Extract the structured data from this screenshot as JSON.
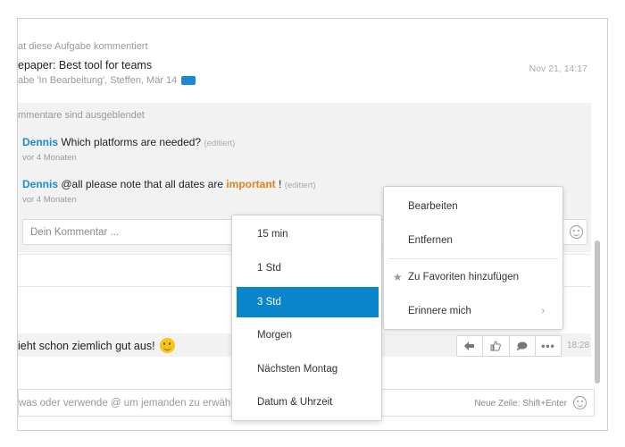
{
  "activity": {
    "header": "at diese Aufgabe kommentiert",
    "title": "epaper: Best tool for teams",
    "meta": "abe 'In Bearbeitung', Steffen, Mär 14",
    "time": "Nov 21, 14:17"
  },
  "comments": {
    "hidden_note": "mmentare sind ausgeblendet",
    "items": [
      {
        "author": "Dennis",
        "text": "Which platforms are needed?",
        "edited": "(editiert)",
        "time": "vor 4 Monaten"
      },
      {
        "author": "Dennis",
        "text_before": "@all please note that all dates are",
        "highlight": "important",
        "text_after": "!",
        "edited": "(editiert)",
        "time": "vor 4 Monaten"
      }
    ],
    "input_placeholder": "Dein Kommentar ..."
  },
  "message": {
    "text": "ieht schon ziemlich gut aus!",
    "time": "18:28"
  },
  "compose": {
    "placeholder": "was oder verwende @ um jemanden zu erwähn",
    "hint": "Neue Zeile: Shift+Enter"
  },
  "reminder_menu": {
    "items": [
      "15 min",
      "1 Std",
      "3 Std",
      "Morgen",
      "Nächsten Montag",
      "Datum & Uhrzeit"
    ],
    "selected": "3 Std"
  },
  "context_menu": {
    "edit": "Bearbeiten",
    "remove": "Entfernen",
    "favorite": "Zu Favoriten hinzufügen",
    "remind": "Erinnere mich"
  },
  "icons": {
    "tag": "blue-tag-icon",
    "reply": "reply-arrow-icon",
    "like": "thumbs-up-icon",
    "comment": "speech-bubble-icon",
    "more": "ellipsis-icon",
    "emoji": "smiley-icon",
    "star": "star-icon",
    "chevron": "chevron-right-icon"
  },
  "colors": {
    "accent": "#0a85cc",
    "author": "#1a8ad4",
    "important": "#e67e22"
  }
}
